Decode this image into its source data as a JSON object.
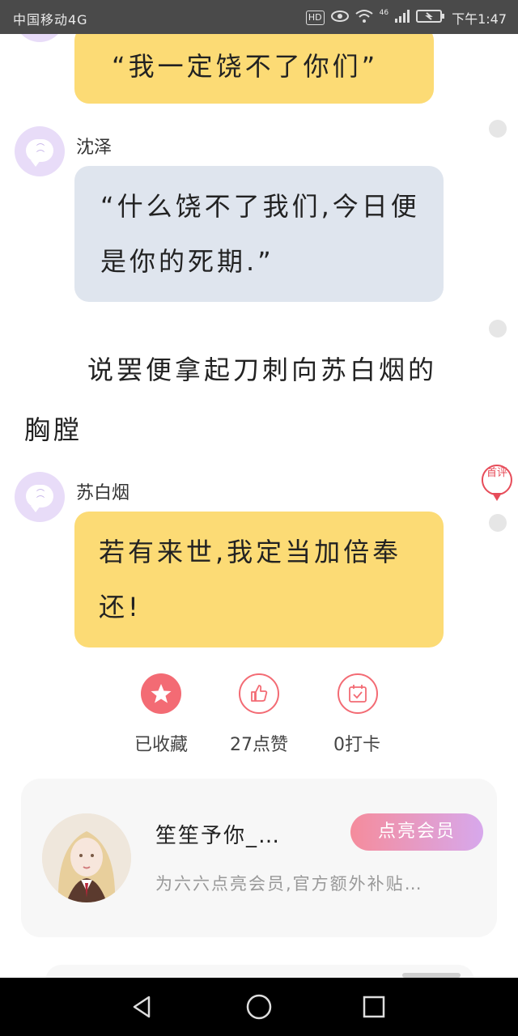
{
  "status_bar": {
    "carrier": "中国移动4G",
    "hd": "HD",
    "signal": "46",
    "time": "下午1:47"
  },
  "messages": [
    {
      "text": "“我一定饶不了你们”"
    },
    {
      "speaker": "沈泽",
      "text": "“什么饶不了我们,今日便是你的死期.”"
    },
    {
      "speaker": "苏白烟",
      "text": "若有来世,我定当加倍奉还!"
    }
  ],
  "narration": "说罢便拿起刀刺向苏白烟的胸膛",
  "comment_badge": "首评",
  "actions": {
    "collect": {
      "label": "已收藏"
    },
    "like": {
      "label": "27点赞"
    },
    "checkin": {
      "label": "0打卡"
    }
  },
  "promo_card": {
    "name": "笙笙予你_…",
    "description": "为六六点亮会员,官方额外补贴…",
    "button": "点亮会员"
  },
  "colors": {
    "accent_red": "#f36b74",
    "yellow_bubble": "#fcdb75",
    "blue_bubble": "#dfe5ee"
  }
}
